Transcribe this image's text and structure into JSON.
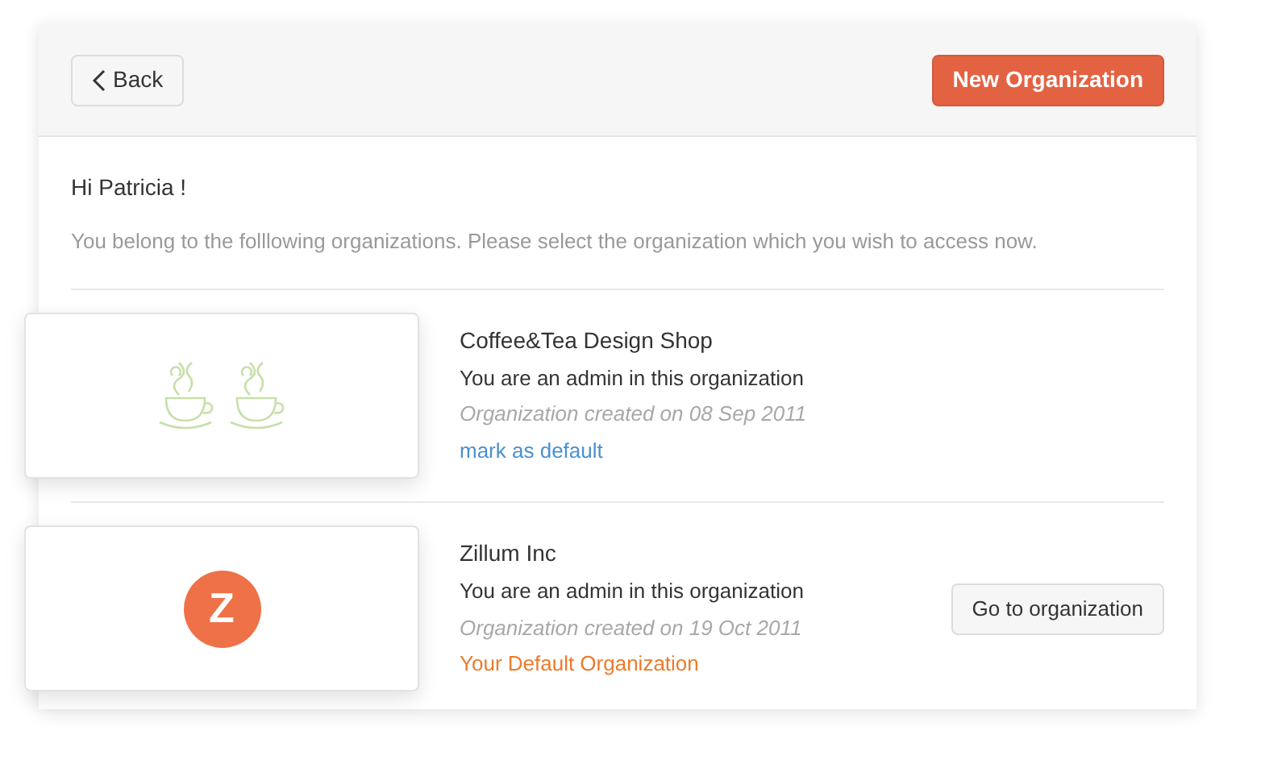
{
  "header": {
    "back_button": "Back",
    "new_button": "New Organization"
  },
  "greeting": "Hi Patricia !",
  "intro": "You belong to the folllowing organizations. Please select the organization which you wish to access now.",
  "organizations": [
    {
      "name": "Coffee&Tea Design Shop",
      "role": "You are an admin in this organization",
      "created": "Organization created on 08 Sep 2011",
      "default": false,
      "default_text": "mark as default",
      "logo": {
        "kind": "cups"
      }
    },
    {
      "name": "Zillum Inc",
      "role": "You are an admin in this organization",
      "created": "Organization created on 19 Oct 2011",
      "default": true,
      "default_text": "Your Default Organization",
      "logo": {
        "kind": "letter",
        "letter": "Z"
      },
      "action": "Go to organization"
    }
  ]
}
